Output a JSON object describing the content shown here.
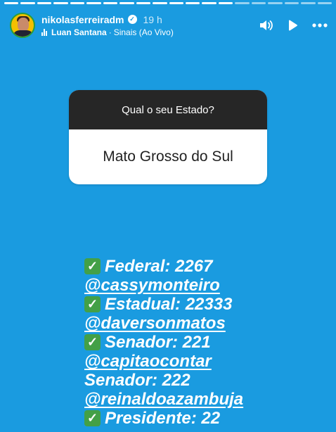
{
  "header": {
    "username": "nikolasferreiradm",
    "time": "19 h",
    "artist": "Luan Santana",
    "separator": "·",
    "song": "Sinais (Ao Vivo)"
  },
  "question": {
    "prompt": "Qual o seu Estado?",
    "answer": "Mato Grosso do Sul"
  },
  "lines": [
    {
      "text": "Federal: 2267",
      "checked": true
    },
    {
      "text": "@cassymonteiro",
      "mention": true
    },
    {
      "text": "Estadual: 22333",
      "checked": true
    },
    {
      "text": "@daversonmatos",
      "mention": true
    },
    {
      "text": "Senador: 221",
      "checked": true
    },
    {
      "text": "@capitaocontar",
      "mention": true
    },
    {
      "text": "Senador: 222",
      "checked": false
    },
    {
      "text": "@reinaldoazambuja",
      "mention": true
    },
    {
      "text": "Presidente: 22",
      "checked": true
    }
  ],
  "colors": {
    "background": "#1a9be0",
    "question_header": "#262626",
    "check": "#43a047"
  },
  "icons": [
    "verified-icon",
    "music-bars-icon",
    "volume-icon",
    "play-icon",
    "more-icon",
    "check-icon"
  ]
}
